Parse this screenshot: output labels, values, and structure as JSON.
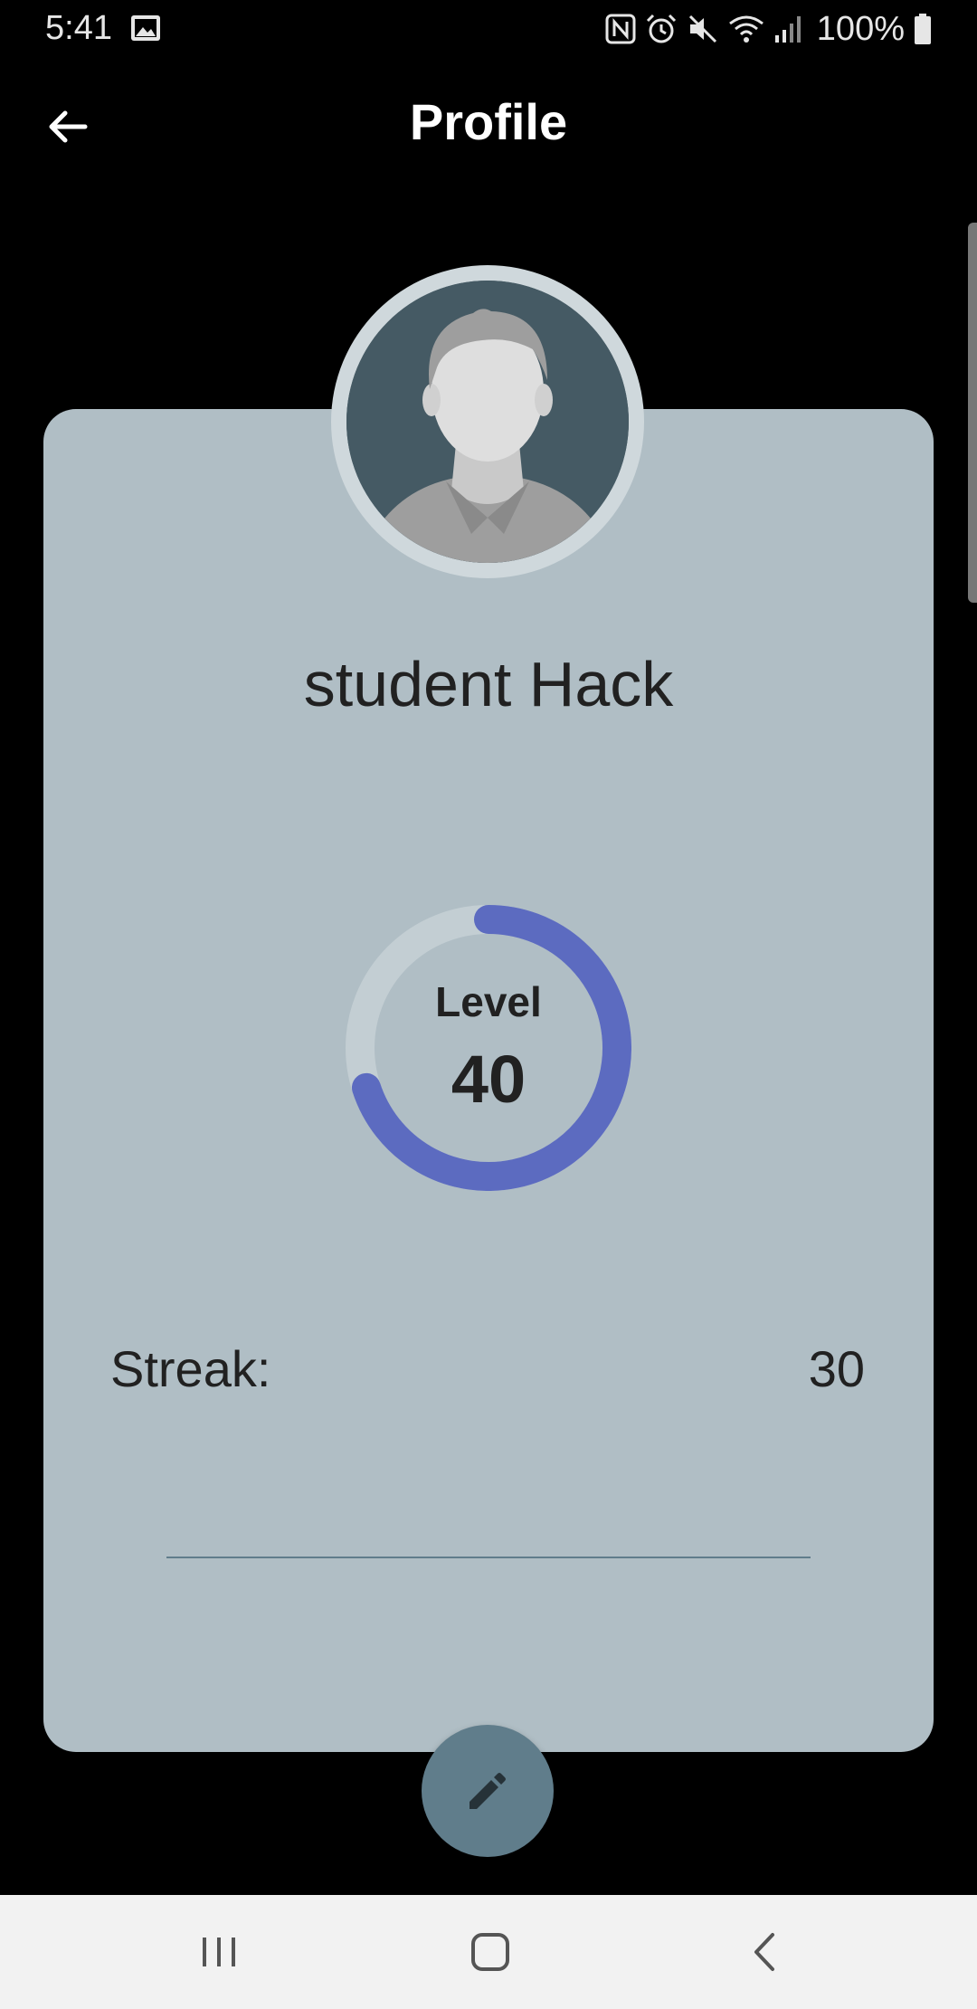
{
  "status_bar": {
    "time": "5:41",
    "battery": "100%",
    "icons": [
      "gallery-icon",
      "nfc-icon",
      "alarm-icon",
      "mute-icon",
      "wifi-icon",
      "signal-icon",
      "battery-icon"
    ]
  },
  "app_bar": {
    "title": "Profile",
    "back_icon": "arrow-back-icon"
  },
  "profile": {
    "name": "student Hack",
    "avatar_icon": "default-avatar",
    "level_label": "Level",
    "level_value": "40",
    "level_progress": 0.7,
    "streak_label": "Streak:",
    "streak_value": "30",
    "edit_icon": "pencil-icon"
  },
  "nav_bar": {
    "buttons": [
      "recent-apps-icon",
      "home-icon",
      "back-icon"
    ]
  },
  "colors": {
    "background": "#000000",
    "card": "#b0bec5",
    "accent": "#5c6bc0",
    "track": "#c3ced3",
    "fab": "#607d8b",
    "text_dark": "#212121"
  }
}
